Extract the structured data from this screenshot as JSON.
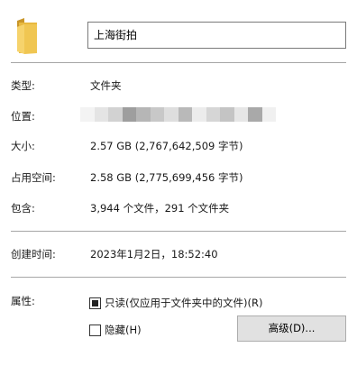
{
  "header": {
    "folder_icon": "folder-icon",
    "folder_name": "上海街拍"
  },
  "properties": {
    "type_label": "类型:",
    "type_value": "文件夹",
    "location_label": "位置:",
    "size_label": "大小:",
    "size_value": "2.57 GB (2,767,642,509 字节)",
    "disk_size_label": "占用空间:",
    "disk_size_value": "2.58 GB (2,775,699,456 字节)",
    "contains_label": "包含:",
    "contains_value": "3,944 个文件，291 个文件夹",
    "created_label": "创建时间:",
    "created_value": "2023年1月2日，18:52:40",
    "attributes_label": "属性:"
  },
  "attributes": {
    "readonly_label": "只读(仅应用于文件夹中的文件)(R)",
    "readonly_state": "indeterminate",
    "hidden_label": "隐藏(H)",
    "hidden_checked": false,
    "advanced_button": "高级(D)..."
  }
}
